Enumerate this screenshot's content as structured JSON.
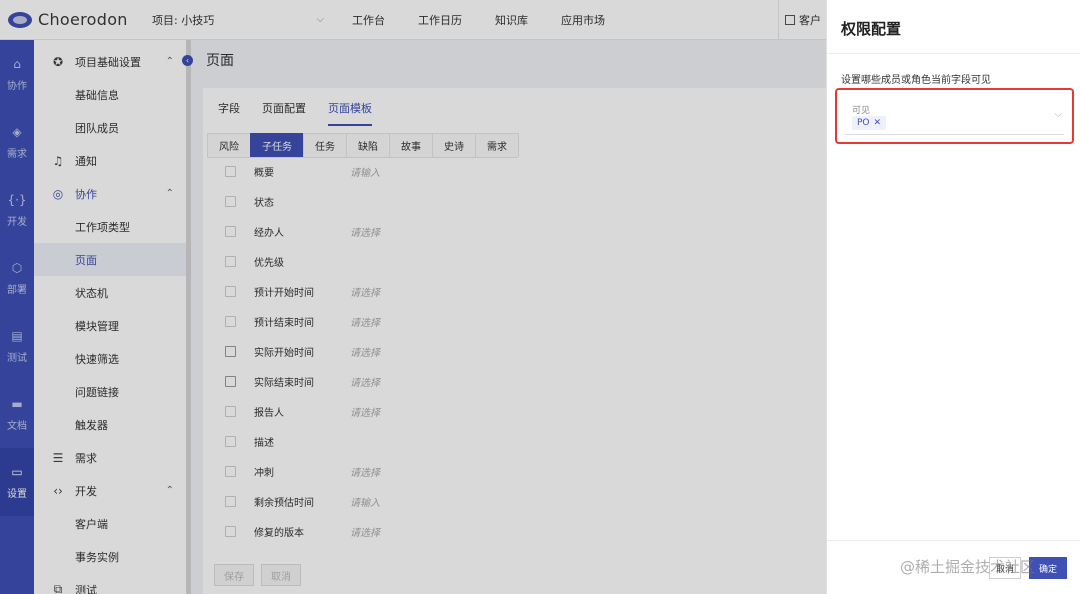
{
  "header": {
    "brand": "Choerodon",
    "project": "项目: 小技巧",
    "nav": [
      "工作台",
      "工作日历",
      "知识库",
      "应用市场"
    ],
    "right_truncated": "客户"
  },
  "rail": [
    {
      "label": "协作",
      "icon": "collab-icon"
    },
    {
      "label": "需求",
      "icon": "layers-icon"
    },
    {
      "label": "开发",
      "icon": "code-icon"
    },
    {
      "label": "部署",
      "icon": "deploy-icon"
    },
    {
      "label": "测试",
      "icon": "clipboard-icon"
    },
    {
      "label": "文档",
      "icon": "folder-icon"
    },
    {
      "label": "设置",
      "icon": "monitor-icon",
      "active": true
    }
  ],
  "sidebar": {
    "groups": [
      {
        "label": "项目基础设置",
        "icon": "settings-globe-icon",
        "items": [
          "基础信息",
          "团队成员"
        ]
      },
      {
        "label": "通知",
        "icon": "bell-icon",
        "items": []
      },
      {
        "label": "协作",
        "icon": "collab-icon",
        "items": [
          "工作项类型",
          "页面",
          "状态机",
          "模块管理",
          "快速筛选",
          "问题链接",
          "触发器"
        ],
        "active_item": "页面"
      },
      {
        "label": "需求",
        "icon": "list-icon",
        "items": []
      },
      {
        "label": "开发",
        "icon": "code-icon",
        "items": [
          "客户端",
          "事务实例"
        ]
      },
      {
        "label": "测试",
        "icon": "test-icon",
        "items": []
      }
    ]
  },
  "main": {
    "title": "页面",
    "tabs": [
      "字段",
      "页面配置",
      "页面模板"
    ],
    "active_tab": "页面模板",
    "subtabs": [
      "风险",
      "子任务",
      "任务",
      "缺陷",
      "故事",
      "史诗",
      "需求"
    ],
    "active_subtab": "子任务",
    "rows": [
      {
        "field": "概要",
        "placeholder": "请输入"
      },
      {
        "field": "状态",
        "placeholder": ""
      },
      {
        "field": "经办人",
        "placeholder": "请选择"
      },
      {
        "field": "优先级",
        "placeholder": ""
      },
      {
        "field": "预计开始时间",
        "placeholder": "请选择"
      },
      {
        "field": "预计结束时间",
        "placeholder": "请选择"
      },
      {
        "field": "实际开始时间",
        "placeholder": "请选择"
      },
      {
        "field": "实际结束时间",
        "placeholder": "请选择"
      },
      {
        "field": "报告人",
        "placeholder": "请选择"
      },
      {
        "field": "描述",
        "placeholder": ""
      },
      {
        "field": "冲刺",
        "placeholder": "请选择"
      },
      {
        "field": "剩余预估时间",
        "placeholder": "请输入"
      },
      {
        "field": "修复的版本",
        "placeholder": "请选择"
      }
    ],
    "footer": {
      "save": "保存",
      "cancel": "取消"
    }
  },
  "drawer": {
    "title": "权限配置",
    "description": "设置哪些成员或角色当前字段可见",
    "select_label": "可见",
    "selected_chip": "PO",
    "cancel": "取消",
    "ok": "确定"
  },
  "watermark": "@稀土掘金技术社区",
  "colors": {
    "primary": "#3f51b5",
    "highlight": "#e53935"
  }
}
